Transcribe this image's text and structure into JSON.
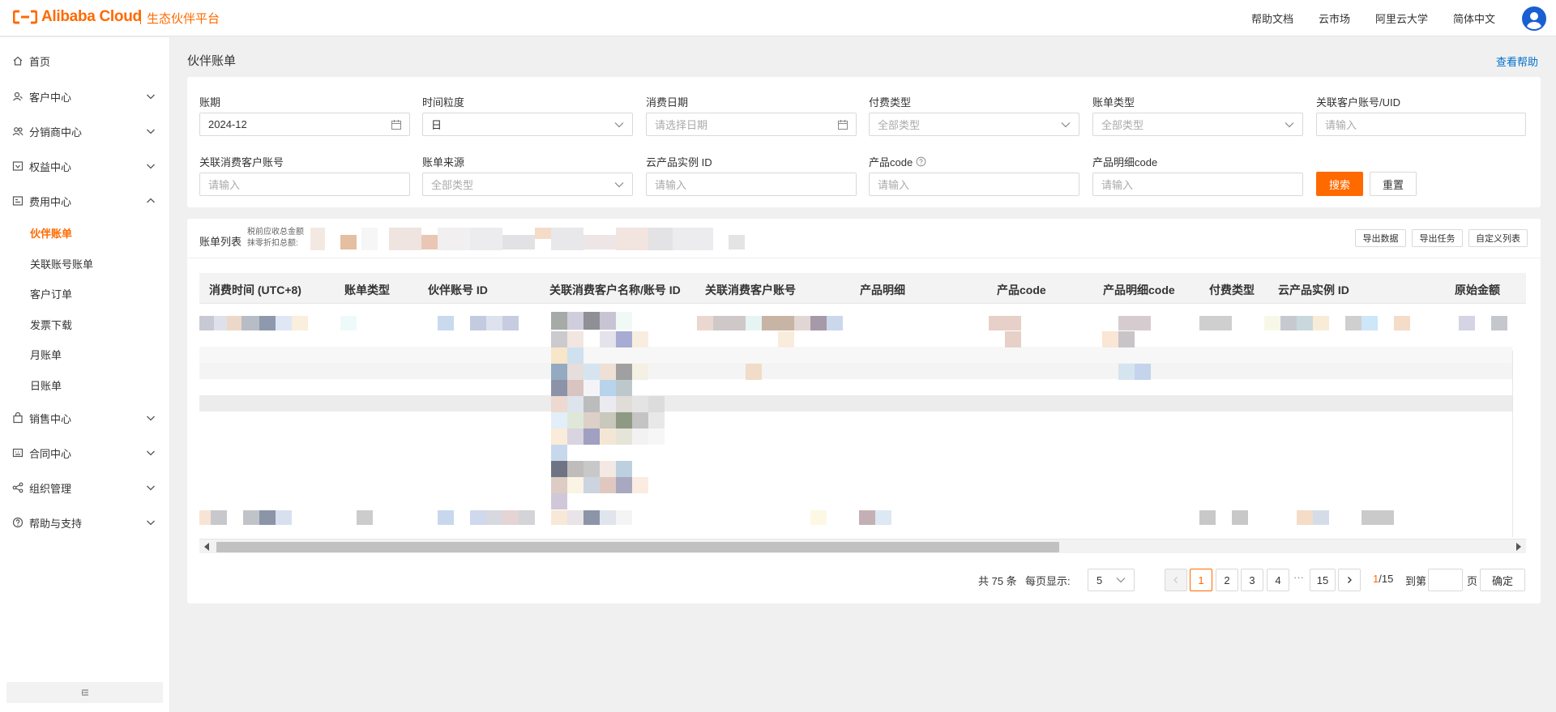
{
  "brand": {
    "logo_text": "Alibaba Cloud",
    "platform": "生态伙伴平台",
    "accent": "#ff6a00"
  },
  "topnav": {
    "items": [
      "帮助文档",
      "云市场",
      "阿里云大学",
      "简体中文"
    ]
  },
  "sidebar": {
    "items": [
      {
        "label": "首页",
        "icon": "home-icon"
      },
      {
        "label": "客户中心",
        "icon": "customer-icon"
      },
      {
        "label": "分销商中心",
        "icon": "distributor-icon"
      },
      {
        "label": "权益中心",
        "icon": "benefit-icon"
      },
      {
        "label": "费用中心",
        "icon": "billing-icon"
      },
      {
        "label": "销售中心",
        "icon": "sales-icon"
      },
      {
        "label": "合同中心",
        "icon": "contract-icon"
      },
      {
        "label": "组织管理",
        "icon": "org-icon"
      },
      {
        "label": "帮助与支持",
        "icon": "help-icon"
      }
    ],
    "subitems": [
      "伙伴账单",
      "关联账号账单",
      "客户订单",
      "发票下载",
      "月账单",
      "日账单"
    ]
  },
  "page": {
    "title": "伙伴账单",
    "help_link": "查看帮助"
  },
  "filters": {
    "period": {
      "label": "账期",
      "value": "2024-12"
    },
    "granularity": {
      "label": "时间粒度",
      "value": "日"
    },
    "consume_date": {
      "label": "消费日期",
      "placeholder": "请选择日期"
    },
    "pay_type": {
      "label": "付费类型",
      "placeholder": "全部类型"
    },
    "bill_type": {
      "label": "账单类型",
      "placeholder": "全部类型"
    },
    "customer_uid": {
      "label": "关联客户账号/UID",
      "placeholder": "请输入"
    },
    "consumer_account": {
      "label": "关联消费客户账号",
      "placeholder": "请输入"
    },
    "bill_source": {
      "label": "账单来源",
      "placeholder": "全部类型"
    },
    "instance_id": {
      "label": "云产品实例 ID",
      "placeholder": "请输入"
    },
    "product_code": {
      "label": "产品code",
      "placeholder": "请输入"
    },
    "product_detail_code": {
      "label": "产品明细code",
      "placeholder": "请输入"
    },
    "search_label": "搜索",
    "reset_label": "重置"
  },
  "table": {
    "title": "账单列表",
    "sum_labels": [
      "税前应收总金额",
      "抹零折扣总额:"
    ],
    "actions": [
      "导出数据",
      "导出任务",
      "自定义列表"
    ],
    "columns": [
      "消费时间 (UTC+8)",
      "账单类型",
      "伙伴账号 ID",
      "关联消费客户名称/账号 ID",
      "关联消费客户账号",
      "产品明细",
      "产品code",
      "产品明细code",
      "付费类型",
      "云产品实例 ID",
      "原始金额"
    ]
  },
  "pagination": {
    "total_text": "共 75 条",
    "page_size_label": "每页显示:",
    "page_size": "5",
    "pages": [
      "1",
      "2",
      "3",
      "4",
      "15"
    ],
    "ellipsis": "···",
    "current": "1",
    "total_pages": "/15",
    "goto_label": "到第",
    "page_unit": "页",
    "confirm_label": "确定"
  }
}
